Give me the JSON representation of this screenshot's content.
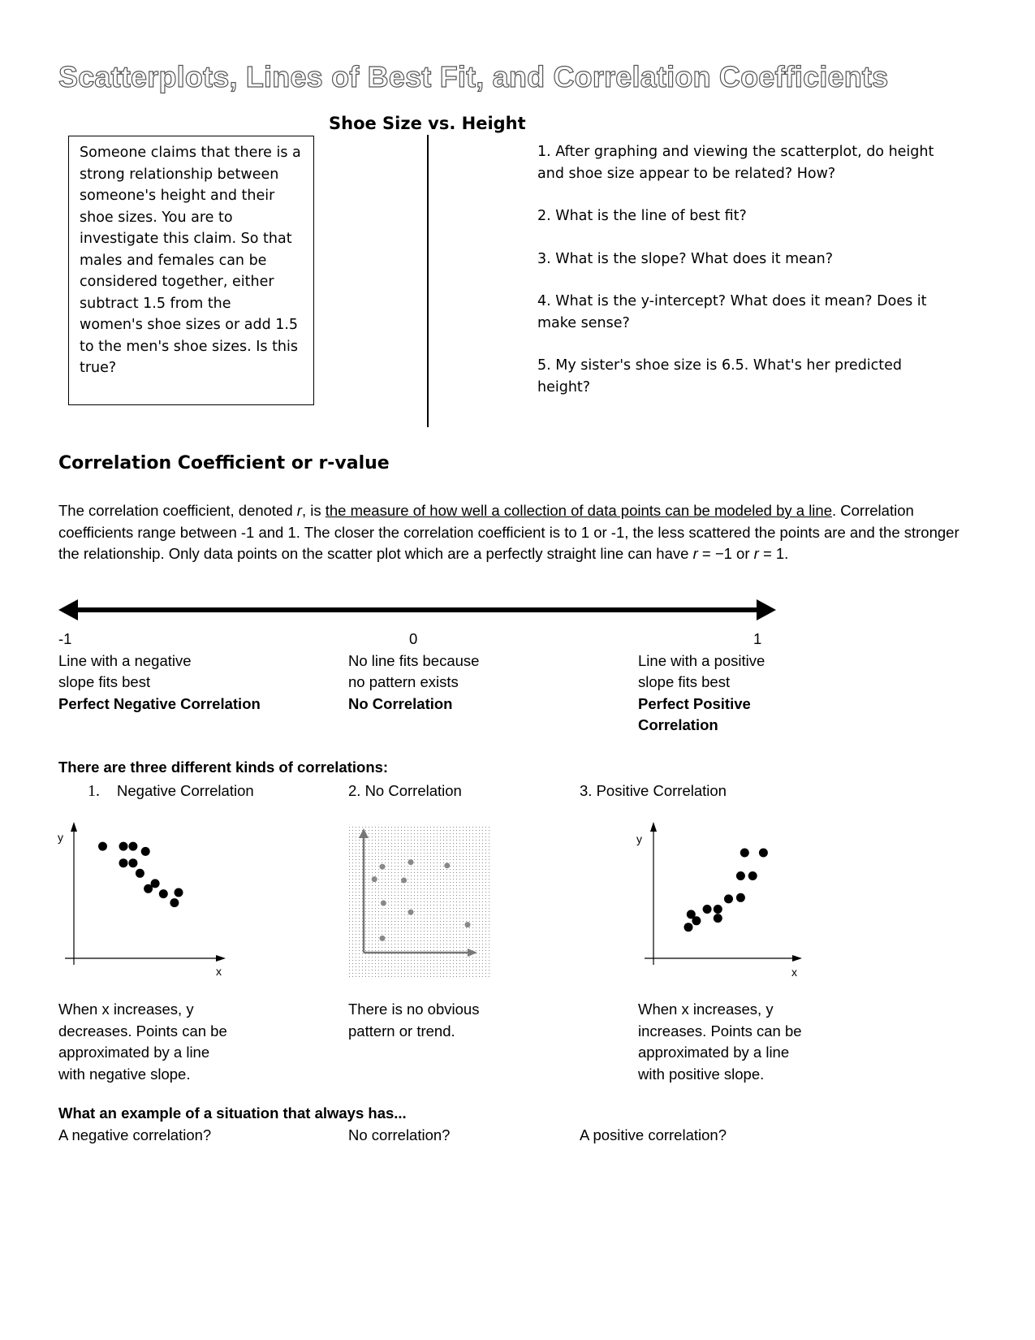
{
  "header": {
    "title": "Scatterplots, Lines of Best Fit, and Correlation Coefficients",
    "subtitle": "Shoe Size vs. Height"
  },
  "claim_box": {
    "lines": [
      "Someone claims that there is a",
      "strong relationship between",
      "someone's height and their",
      "shoe sizes.  You are to",
      "investigate this claim.  So that",
      "males and females can be",
      "considered together, either",
      "subtract 1.5 from the",
      "women's shoe sizes or add 1.5",
      "to the men's shoe sizes.  Is this",
      "true?"
    ]
  },
  "questions": [
    "1.  After graphing and viewing the scatterplot, do height and shoe size appear to be related? How?",
    "2.  What is the line of best fit?",
    "3.  What is the slope?  What does it mean?",
    "4.  What is the y-intercept?  What does it mean?  Does it make sense?",
    "5.  My sister's shoe size is 6.5.  What's her predicted height?"
  ],
  "correlation_section": {
    "heading": "Correlation Coefficient or r-value",
    "para_part1": "The correlation coefficient, denoted ",
    "para_r": "r",
    "para_part2": ", is ",
    "para_underlined": "the measure of how well a collection of data points can be modeled by a line",
    "para_part3": ". Correlation coefficients range between -1 and 1. The closer the correlation coefficient is to 1 or -1, the less scattered the points are and the stronger the relationship. Only data points on the scatter plot which are a perfectly straight line can have ",
    "para_r2": "r",
    "para_part4": " = −1 or ",
    "para_r3": "r",
    "para_part5": " = 1."
  },
  "number_line": {
    "left": {
      "value": "-1",
      "line1": "Line with a negative",
      "line2": "slope fits best",
      "bold": "Perfect Negative Correlation"
    },
    "middle": {
      "value": "0",
      "line1": "No line fits because",
      "line2": "no pattern exists",
      "bold": "No Correlation"
    },
    "right": {
      "value": "1",
      "line1": "Line with a positive",
      "line2": "slope fits best",
      "bold1": "Perfect Positive",
      "bold2": "Correlation"
    }
  },
  "kinds": {
    "heading": "There are three different kinds of correlations:",
    "negative": {
      "num": "1.",
      "label": "Negative Correlation",
      "desc": [
        "When x increases, y",
        "decreases. Points can be",
        "approximated by a line",
        "with negative slope."
      ],
      "axis_x": "x",
      "axis_y": "y"
    },
    "none": {
      "label": "2. No Correlation",
      "desc": [
        "There is no obvious",
        "pattern or trend."
      ]
    },
    "positive": {
      "label": "3. Positive Correlation",
      "desc": [
        "When x increases, y",
        "increases.  Points can be",
        "approximated by a line",
        "with positive slope."
      ],
      "axis_x": "x",
      "axis_y": "y"
    }
  },
  "examples": {
    "heading": "What an example of a situation that always has...",
    "negative": "A negative correlation?",
    "none": "No correlation?",
    "positive": "A positive correlation?"
  },
  "chart_data": [
    {
      "type": "scatter",
      "title": "Negative Correlation",
      "xlabel": "x",
      "ylabel": "y",
      "xlim": [
        0,
        10
      ],
      "ylim": [
        0,
        10
      ],
      "points": [
        [
          1.5,
          8.6
        ],
        [
          3,
          8.6
        ],
        [
          3.7,
          8.6
        ],
        [
          4.6,
          8.2
        ],
        [
          3,
          7.3
        ],
        [
          3.7,
          7.3
        ],
        [
          4.2,
          6.5
        ],
        [
          5.3,
          5.7
        ],
        [
          4.8,
          5.3
        ],
        [
          5.9,
          4.9
        ],
        [
          7,
          5
        ],
        [
          6.7,
          4.2
        ]
      ]
    },
    {
      "type": "scatter",
      "title": "No Correlation",
      "xlabel": "",
      "ylabel": "",
      "xlim": [
        0,
        10
      ],
      "ylim": [
        0,
        10
      ],
      "points": [
        [
          1.5,
          7.2
        ],
        [
          4,
          7.6
        ],
        [
          0.8,
          6.1
        ],
        [
          3.4,
          6
        ],
        [
          7.2,
          7.3
        ],
        [
          1.6,
          4
        ],
        [
          4,
          3.2
        ],
        [
          9,
          2.1
        ],
        [
          1.5,
          0.9
        ]
      ]
    },
    {
      "type": "scatter",
      "title": "Positive Correlation",
      "xlabel": "x",
      "ylabel": "y",
      "xlim": [
        0,
        10
      ],
      "ylim": [
        0,
        10
      ],
      "points": [
        [
          2,
          2.3
        ],
        [
          2.6,
          2.8
        ],
        [
          3.4,
          3.7
        ],
        [
          4.2,
          3.7
        ],
        [
          4.2,
          3
        ],
        [
          5,
          4.5
        ],
        [
          5.9,
          4.6
        ],
        [
          5.9,
          6.3
        ],
        [
          6.8,
          6.3
        ],
        [
          6.2,
          8.1
        ],
        [
          7.6,
          8.1
        ],
        [
          2.2,
          3.3
        ]
      ]
    }
  ]
}
